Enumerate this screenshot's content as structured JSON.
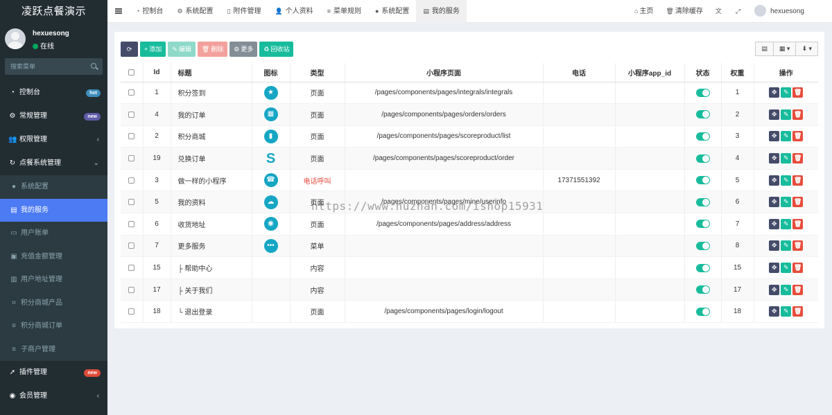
{
  "brand": "凌跃点餐演示",
  "user": {
    "name": "hexuesong",
    "status": "在线"
  },
  "search": {
    "placeholder": "搜索菜单"
  },
  "colors": {
    "sidebar": "#222d32",
    "active": "#4c7bf3",
    "success": "#18bc9c",
    "danger": "#e74c3c",
    "info_blue": "#15a6c4"
  },
  "sidebar": {
    "items": [
      {
        "icon": "dashboard-icon",
        "label": "控制台",
        "badge": "hot",
        "badge_color": "#3c8dbc"
      },
      {
        "icon": "gears-icon",
        "label": "常规管理",
        "badge": "new",
        "badge_color": "#605ca8"
      },
      {
        "icon": "group-icon",
        "label": "权限管理",
        "caret": "‹"
      },
      {
        "icon": "refresh-icon",
        "label": "点餐系统管理",
        "caret": "⌄"
      }
    ],
    "submenu": [
      {
        "icon": "circle-icon",
        "label": "系统配置"
      },
      {
        "icon": "list-alt-icon",
        "label": "我的服务",
        "active": true
      },
      {
        "icon": "credit-card-icon",
        "label": "用户账单"
      },
      {
        "icon": "money-icon",
        "label": "充值金额管理"
      },
      {
        "icon": "book-icon",
        "label": "用户地址管理"
      },
      {
        "icon": "tags-icon",
        "label": "积分商城产品"
      },
      {
        "icon": "list-icon",
        "label": "积分商城订单"
      },
      {
        "icon": "list-icon",
        "label": "子商户管理"
      }
    ],
    "bottom": [
      {
        "icon": "rocket-icon",
        "label": "插件管理",
        "badge": "new",
        "badge_color": "#dd4b39"
      },
      {
        "icon": "user-circle-icon",
        "label": "会员管理",
        "caret": "‹"
      }
    ]
  },
  "topnav": {
    "tabs": [
      {
        "icon": "dashboard-icon",
        "label": "控制台"
      },
      {
        "icon": "cog-icon",
        "label": "系统配置"
      },
      {
        "icon": "file-icon",
        "label": "附件管理"
      },
      {
        "icon": "user-icon",
        "label": "个人资料"
      },
      {
        "icon": "bars-icon",
        "label": "菜单规则"
      },
      {
        "icon": "circle-icon",
        "label": "系统配置"
      },
      {
        "icon": "list-alt-icon",
        "label": "我的服务",
        "active": true
      }
    ],
    "home": "主页",
    "clear_cache": "清除缓存",
    "username": "hexuesong"
  },
  "toolbar": {
    "add": "添加",
    "edit": "编辑",
    "delete": "删除",
    "more": "更多",
    "recycle": "回收站"
  },
  "table": {
    "headers": [
      "Id",
      "标题",
      "图标",
      "类型",
      "小程序页面",
      "电话",
      "小程序app_id",
      "状态",
      "权重",
      "操作"
    ],
    "rows": [
      {
        "id": "1",
        "title": "积分签到",
        "icon": "star-icon",
        "glyph": "★",
        "type": "页面",
        "page": "/pages/components/pages/integrals/integrals",
        "phone": "",
        "appid": "",
        "weight": "1"
      },
      {
        "id": "4",
        "title": "我的订单",
        "icon": "calendar-icon",
        "glyph": "▦",
        "type": "页面",
        "page": "/pages/components/pages/orders/orders",
        "phone": "",
        "appid": "",
        "weight": "2"
      },
      {
        "id": "2",
        "title": "积分商城",
        "icon": "bookmark-icon",
        "glyph": "▮",
        "type": "页面",
        "page": "/pages/components/pages/scoreproduct/list",
        "phone": "",
        "appid": "",
        "weight": "3"
      },
      {
        "id": "19",
        "title": "兑换订单",
        "icon": "s-icon",
        "glyph": "S",
        "type": "页面",
        "page": "/pages/components/pages/scoreproduct/order",
        "phone": "",
        "appid": "",
        "weight": "4"
      },
      {
        "id": "3",
        "title": "做一样的小程序",
        "icon": "headset-icon",
        "glyph": "☎",
        "type": "电话呼叫",
        "type_red": true,
        "page": "",
        "phone": "17371551392",
        "appid": "",
        "weight": "5"
      },
      {
        "id": "5",
        "title": "我的资料",
        "icon": "cloud-upload-icon",
        "glyph": "☁",
        "type": "页面",
        "page": "/pages/components/pages/mine/userinfo",
        "phone": "",
        "appid": "",
        "weight": "6"
      },
      {
        "id": "6",
        "title": "收货地址",
        "icon": "location-icon",
        "glyph": "◉",
        "type": "页面",
        "page": "/pages/components/pages/address/address",
        "phone": "",
        "appid": "",
        "weight": "7"
      },
      {
        "id": "7",
        "title": "更多服务",
        "icon": "more-icon",
        "glyph": "•••",
        "type": "菜单",
        "page": "",
        "phone": "",
        "appid": "",
        "weight": "8"
      },
      {
        "id": "15",
        "title": "├ 帮助中心",
        "icon": "",
        "glyph": "",
        "type": "内容",
        "page": "",
        "phone": "",
        "appid": "",
        "weight": "15"
      },
      {
        "id": "17",
        "title": "├ 关于我们",
        "icon": "",
        "glyph": "",
        "type": "内容",
        "page": "",
        "phone": "",
        "appid": "",
        "weight": "17"
      },
      {
        "id": "18",
        "title": "└ 退出登录",
        "icon": "",
        "glyph": "",
        "type": "页面",
        "page": "/pages/components/pages/login/logout",
        "phone": "",
        "appid": "",
        "weight": "18"
      }
    ]
  },
  "watermark": "https://www.huzhan.com/ishop15931"
}
